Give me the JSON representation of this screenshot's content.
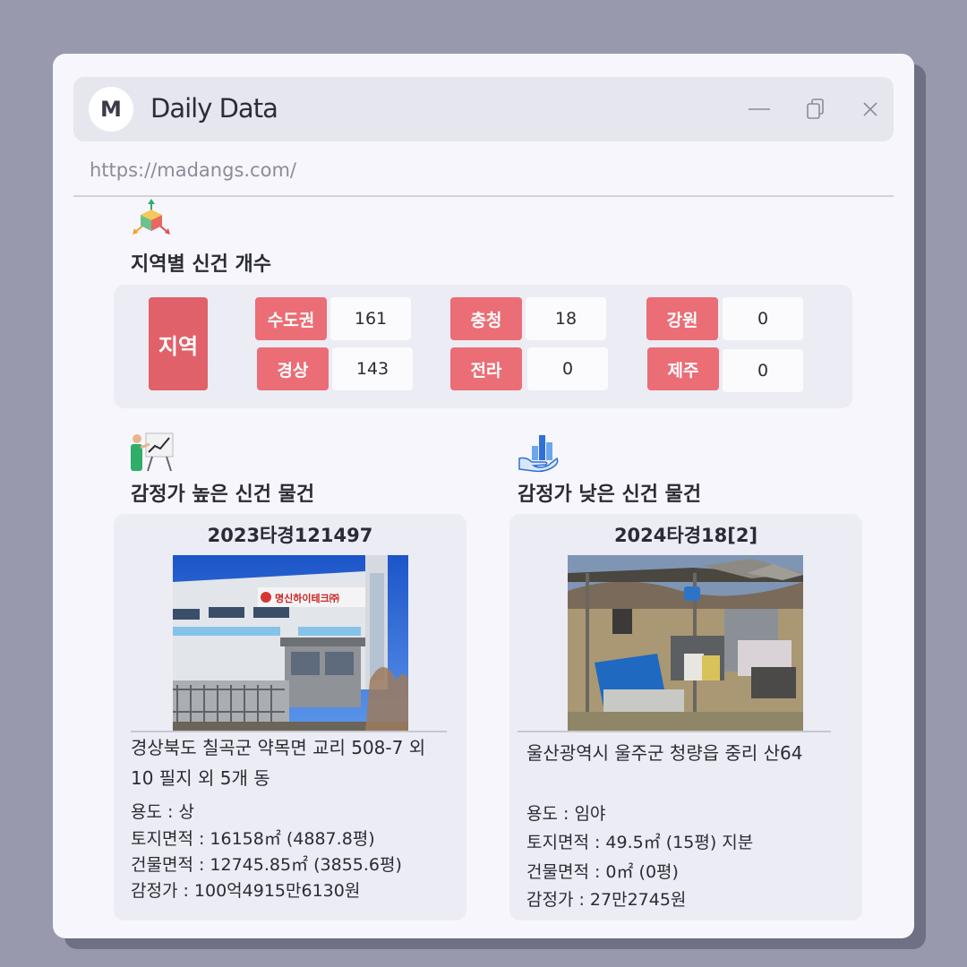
{
  "app": {
    "logo_letter": "M",
    "title": "Daily Data",
    "url": "https://madangs.com/"
  },
  "window_controls": {
    "minimize": "minimize-icon",
    "copy": "copy-icon",
    "close": "close-icon"
  },
  "region_section": {
    "title": "지역별 신건 개수",
    "main_label": "지역",
    "regions": [
      {
        "label": "수도권",
        "count": "161"
      },
      {
        "label": "경상",
        "count": "143"
      },
      {
        "label": "충청",
        "count": "18"
      },
      {
        "label": "전라",
        "count": "0"
      },
      {
        "label": "강원",
        "count": "0"
      },
      {
        "label": "제주",
        "count": "0"
      }
    ]
  },
  "high_section": {
    "title": "감정가 높은 신건 물건",
    "case_no": "2023타경121497",
    "address_line1": "경상북도 칠곡군 약목면 교리 508-7 외",
    "address_line2": "10 필지 외 5개 동",
    "usage": "용도 : 상",
    "land_area": "토지면적 : 16158㎡ (4887.8평)",
    "building_area": "건물면적 : 12745.85㎡ (3855.6평)",
    "price": "감정가 : 100억4915만6130원",
    "sign_text": "명신하이테크㈜"
  },
  "low_section": {
    "title": "감정가 낮은 신건 물건",
    "case_no": "2024타경18[2]",
    "address_line1": "울산광역시 울주군 청량읍 중리 산64",
    "usage": "용도 : 임야",
    "land_area": "토지면적 : 49.5㎡ (15평) 지분",
    "building_area": "건물면적 : 0㎡ (0평)",
    "price": "감정가 : 27만2745원"
  },
  "colors": {
    "accent": "#eb6d75",
    "accent_dark": "#e06169",
    "panel": "#ececf5"
  }
}
